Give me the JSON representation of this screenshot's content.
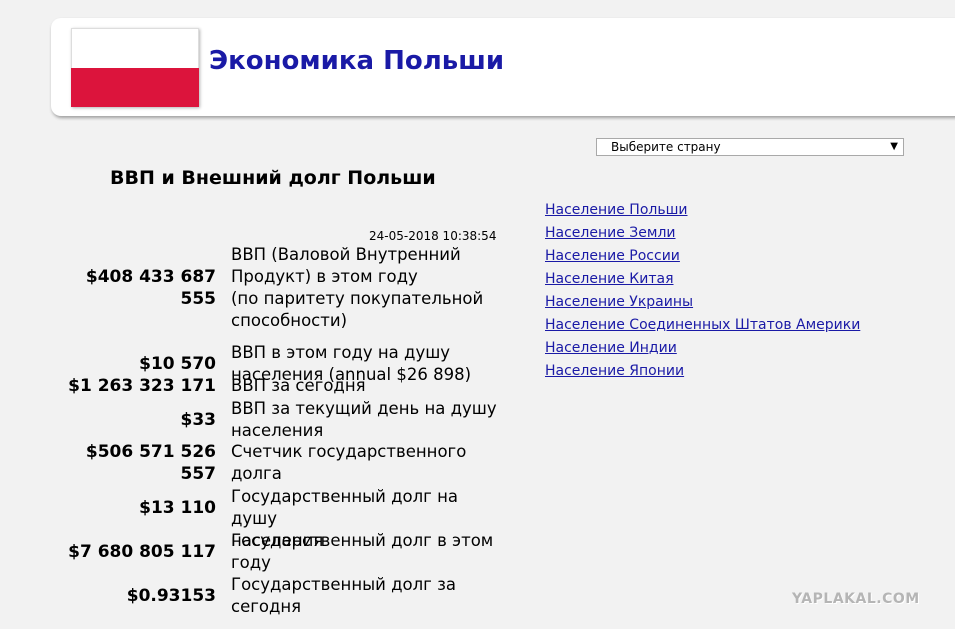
{
  "header": {
    "title": "Экономика Польши",
    "flag": {
      "top_color": "#ffffff",
      "bottom_color": "#dc143c"
    }
  },
  "country_select": {
    "selected": "Выберите страну"
  },
  "section_title": "ВВП и Внешний долг Польши",
  "timestamp": "24-05-2018 10:38:54",
  "stats": [
    {
      "value_lines": [
        "$408 433 687",
        "555"
      ],
      "label_lines": [
        "ВВП (Валовой Внутренний",
        "Продукт) в этом году",
        "(по паритету покупательной",
        "способности)"
      ]
    },
    {
      "value_lines": [
        "$10 570"
      ],
      "label_lines": [
        "ВВП в этом году на душу",
        "населения (annual $26 898)"
      ]
    },
    {
      "value_lines": [
        "$1 263 323 171"
      ],
      "label_lines": [
        "ВВП за сегодня"
      ]
    },
    {
      "value_lines": [
        "$33"
      ],
      "label_lines": [
        "ВВП за текущий день на душу",
        "населения"
      ]
    },
    {
      "value_lines": [
        "$506 571 526",
        "557"
      ],
      "label_lines": [
        "Счетчик государственного",
        "долга"
      ]
    },
    {
      "value_lines": [
        "$13 110"
      ],
      "label_lines": [
        "Государственный долг на душу",
        "населения"
      ]
    },
    {
      "value_lines": [
        "$7 680 805 117"
      ],
      "label_lines": [
        "Государственный долг в этом",
        "году"
      ]
    },
    {
      "value_lines": [
        "$0.93153"
      ],
      "label_lines": [
        "Государственный долг за",
        "сегодня"
      ]
    }
  ],
  "links": [
    "Население Польши",
    "Население Земли",
    "Население России",
    "Население Китая",
    "Население Украины",
    "Население Соединенных Штатов Америки",
    "Население Индии",
    "Население Японии"
  ],
  "watermark": "YAPLAKAL.COM",
  "colors": {
    "link": "#1a1aa6",
    "title": "#1a1aa6",
    "background": "#f2f2f2"
  }
}
